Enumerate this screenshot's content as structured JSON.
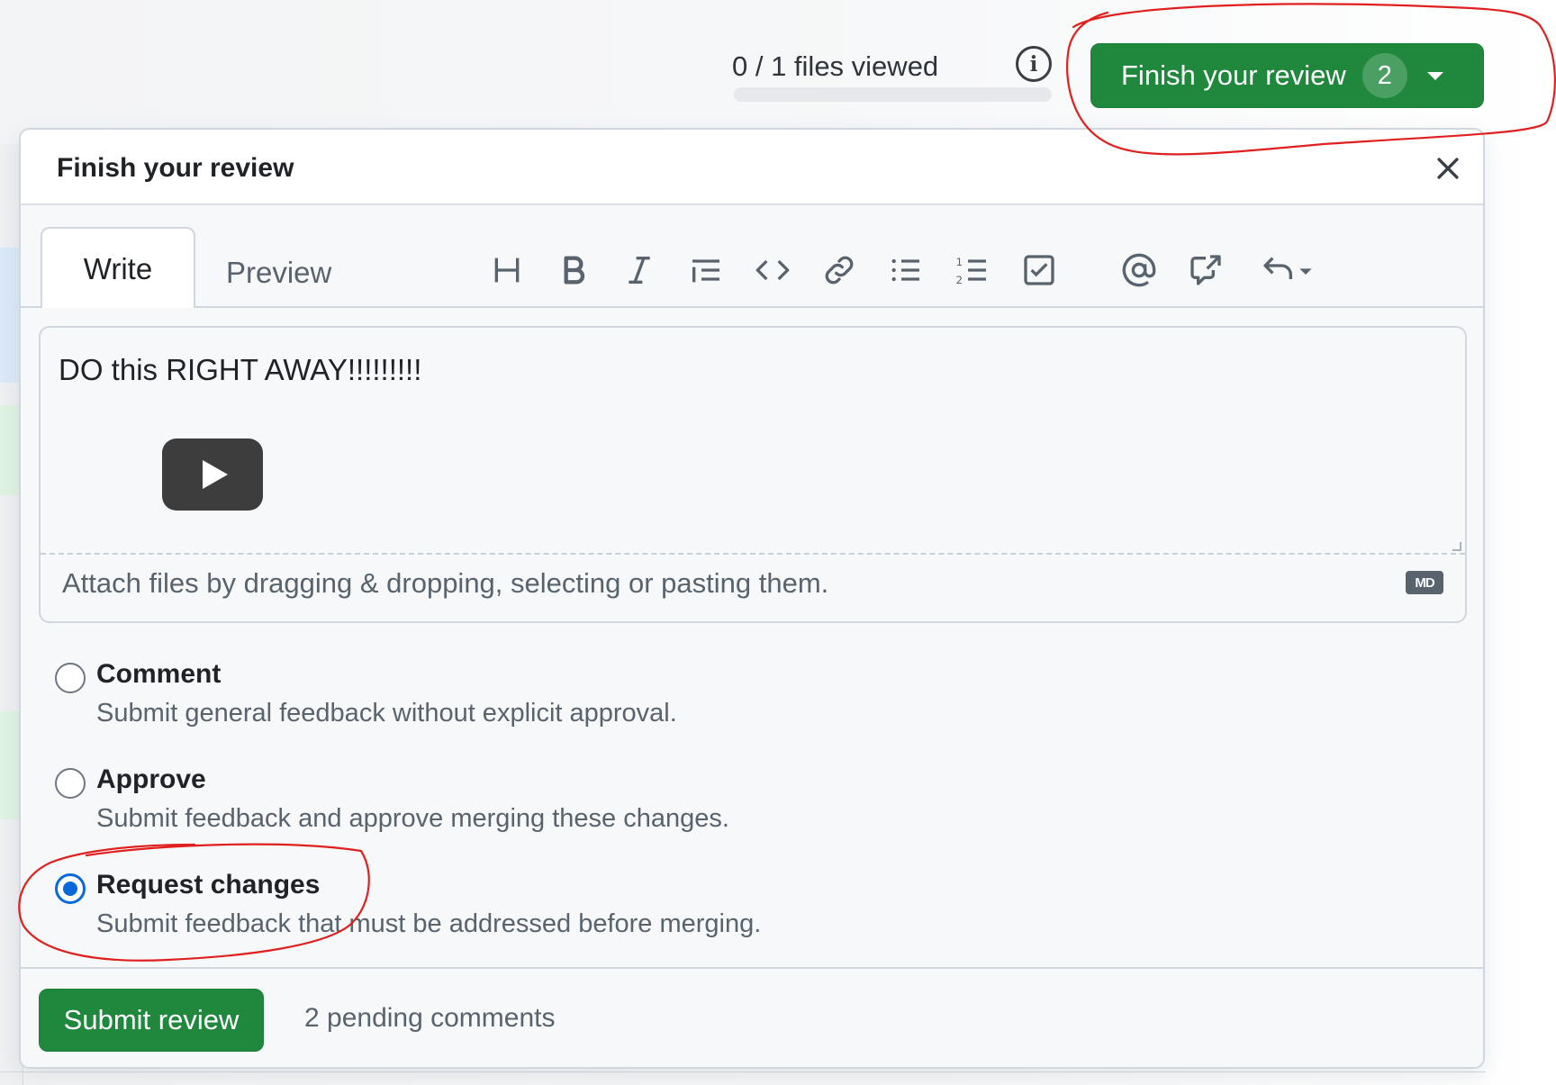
{
  "topbar": {
    "files_viewed": "0 / 1 files viewed",
    "files_viewed_progress": 0,
    "finish_button_label": "Finish your review",
    "finish_button_count": "2"
  },
  "dialog": {
    "title": "Finish your review",
    "tabs": {
      "write": "Write",
      "preview": "Preview"
    },
    "toolbar_icons": [
      "heading-icon",
      "bold-icon",
      "italic-icon",
      "quote-icon",
      "code-icon",
      "link-icon",
      "unordered-list-icon",
      "ordered-list-icon",
      "task-list-icon",
      "mention-icon",
      "reference-icon",
      "reply-icon"
    ],
    "editor_text": "DO this RIGHT AWAY!!!!!!!!!",
    "attach_hint": "Attach files by dragging & dropping, selecting or pasting them.",
    "markdown_badge": "MD",
    "options": [
      {
        "label": "Comment",
        "description": "Submit general feedback without explicit approval.",
        "selected": false
      },
      {
        "label": "Approve",
        "description": "Submit feedback and approve merging these changes.",
        "selected": false
      },
      {
        "label": "Request changes",
        "description": "Submit feedback that must be addressed before merging.",
        "selected": true
      }
    ],
    "submit_label": "Submit review",
    "pending_text": "2 pending comments"
  },
  "colors": {
    "primary_green": "#1f883d",
    "radio_blue": "#0969da",
    "annotation_red": "#e0201f"
  }
}
